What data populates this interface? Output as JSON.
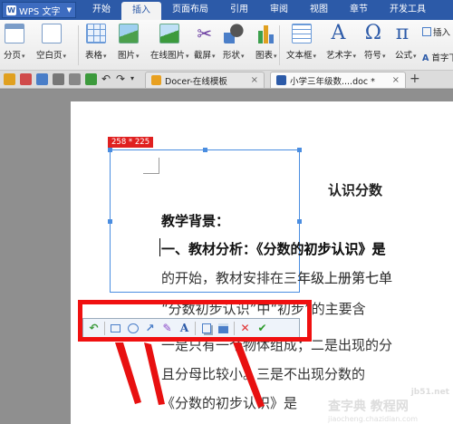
{
  "app": {
    "title": "WPS 文字"
  },
  "menu_tabs": [
    "开始",
    "插入",
    "页面布局",
    "引用",
    "审阅",
    "视图",
    "章节",
    "开发工具"
  ],
  "active_menu_tab": "插入",
  "ribbon": {
    "buttons": [
      "分页",
      "空白页",
      "表格",
      "图片",
      "在线图片",
      "截屏",
      "形状",
      "图表",
      "文本框",
      "艺术字",
      "符号",
      "公式",
      "首字下沉"
    ],
    "insert_label": "插入"
  },
  "doc_tabs": [
    {
      "label": "Docer-在线模板",
      "close": "×"
    },
    {
      "label": "小学三年级数....doc *",
      "close": "×"
    }
  ],
  "new_tab_symbol": "+",
  "document": {
    "title": "认识分数",
    "lines": [
      "教学背景：",
      "一、教材分析：《分数的初步认识》是",
      "的开始，教材安排在三年级上册第七单",
      "“分数初步认识”中“初步”的主要含",
      "一是只有一个物体组成；二是出现的分",
      "且分母比较小。三是不出现分数的",
      "《分数的初步认识》是"
    ]
  },
  "screenshot": {
    "size_label": "258 * 225"
  },
  "capture_toolbar": {
    "tools": [
      "undo-icon",
      "rectangle-icon",
      "ellipse-icon",
      "arrow-icon",
      "pen-icon",
      "text-icon",
      "copy-icon",
      "save-icon",
      "cancel-icon",
      "confirm-icon"
    ]
  },
  "watermark": {
    "line1": "查字典 教程网",
    "line2": "jiaocheng.chazidian.com",
    "line3": "jb51.net"
  },
  "colors": {
    "title_bar": "#2c5aa8",
    "highlight": "#f01010",
    "selection": "#4a8de0"
  }
}
